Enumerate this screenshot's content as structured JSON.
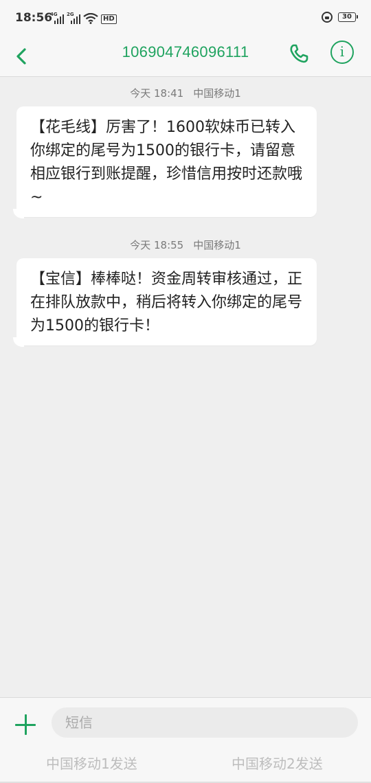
{
  "status_bar": {
    "time": "18:56",
    "sim1_tag": "4G",
    "sim2_tag": "2G",
    "hd_label": "HD",
    "battery_level": "30"
  },
  "header": {
    "title": "106904746096111",
    "accent_color": "#1fa35f"
  },
  "messages": [
    {
      "timestamp": "今天 18:41",
      "carrier": "中国移动1",
      "body": "【花毛线】厉害了！1600软妹币已转入你绑定的尾号为1500的银行卡，请留意相应银行到账提醒，珍惜信用按时还款哦~"
    },
    {
      "timestamp": "今天 18:55",
      "carrier": "中国移动1",
      "body": "【宝信】棒棒哒！资金周转审核通过，正在排队放款中，稍后将转入你绑定的尾号为1500的银行卡！"
    }
  ],
  "composer": {
    "placeholder": "短信",
    "send_sim1_label": "中国移动1发送",
    "send_sim2_label": "中国移动2发送"
  },
  "icons": {
    "back": "chevron-left-icon",
    "call": "phone-icon",
    "info": "info-icon",
    "add": "plus-icon"
  }
}
